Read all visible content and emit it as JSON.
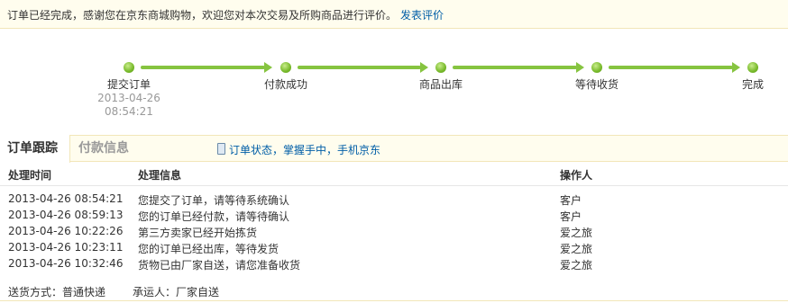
{
  "notice": {
    "message": "订单已经完成，感谢您在京东商城购物，欢迎您对本次交易及所购商品进行评价。",
    "link": "发表评价"
  },
  "progress": {
    "steps": [
      {
        "label": "提交订单",
        "date": "2013-04-26",
        "time": "08:54:21"
      },
      {
        "label": "付款成功"
      },
      {
        "label": "商品出库"
      },
      {
        "label": "等待收货"
      },
      {
        "label": "完成"
      }
    ]
  },
  "tabs": {
    "order_tracking": "订单跟踪",
    "payment_info": "付款信息",
    "promo": "订单状态，掌握手中，手机京东"
  },
  "table": {
    "headers": {
      "time": "处理时间",
      "info": "处理信息",
      "operator": "操作人"
    },
    "rows": [
      {
        "time": "2013-04-26 08:54:21",
        "info": "您提交了订单，请等待系统确认",
        "operator": "客户"
      },
      {
        "time": "2013-04-26 08:59:13",
        "info": "您的订单已经付款，请等待确认",
        "operator": "客户"
      },
      {
        "time": "2013-04-26 10:22:26",
        "info": "第三方卖家已经开始拣货",
        "operator": "爱之旅"
      },
      {
        "time": "2013-04-26 10:23:11",
        "info": "您的订单已经出库，等待发货",
        "operator": "爱之旅"
      },
      {
        "time": "2013-04-26 10:32:46",
        "info": "货物已由厂家自送，请您准备收货",
        "operator": "爱之旅"
      }
    ]
  },
  "shipping": {
    "method_label": "送货方式：",
    "method": "普通快递",
    "carrier_label": "承运人：",
    "carrier": "厂家自送"
  },
  "colors": {
    "accent": "#86c440",
    "link": "#005ea7",
    "banner": "#fffdee"
  }
}
